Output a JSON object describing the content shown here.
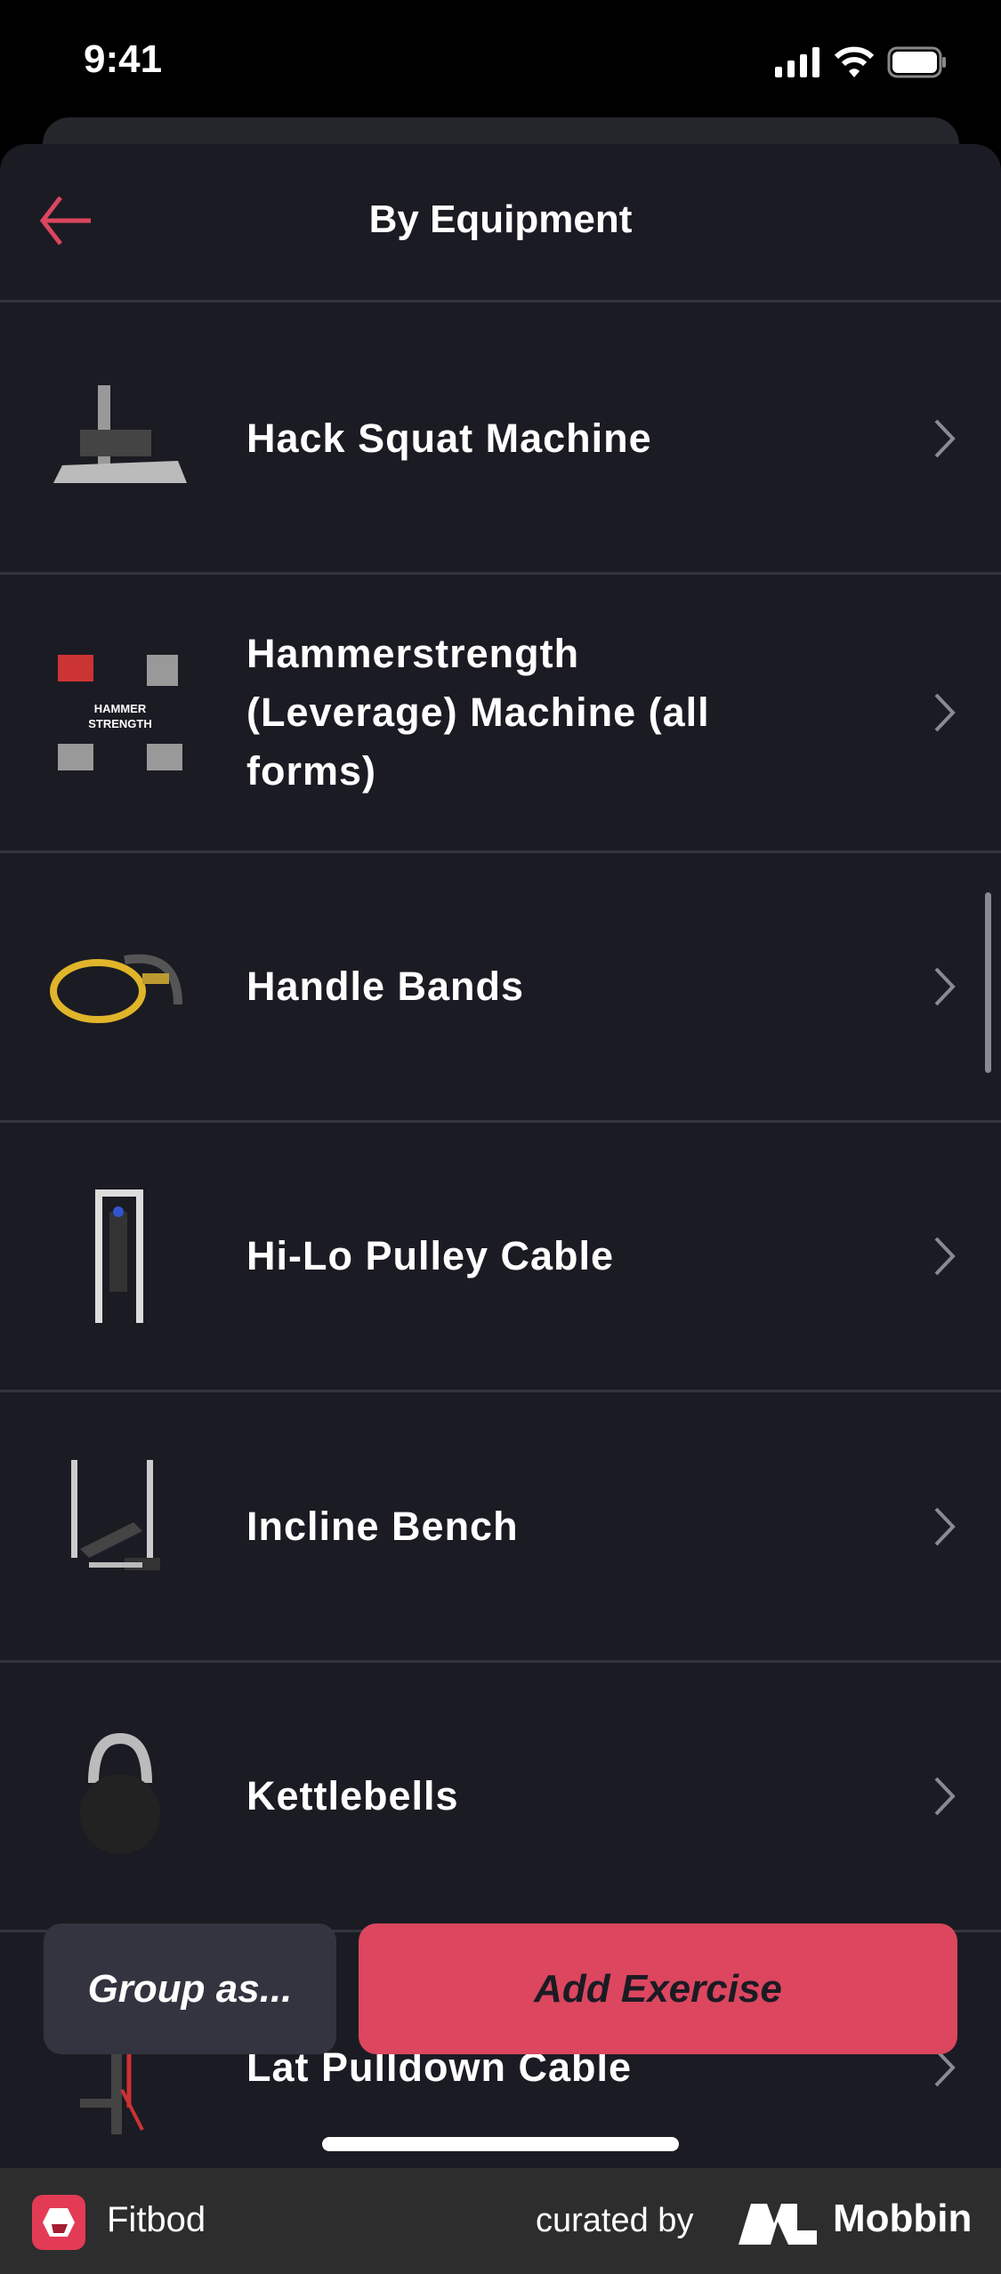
{
  "status_bar": {
    "time": "9:41"
  },
  "header": {
    "title": "By Equipment"
  },
  "items": [
    {
      "label": "Hack Squat Machine"
    },
    {
      "label": "Hammerstrength (Leverage) Machine (all forms)",
      "logo_text": "HAMMER STRENGTH"
    },
    {
      "label": "Handle Bands"
    },
    {
      "label": "Hi-Lo Pulley Cable"
    },
    {
      "label": "Incline Bench"
    },
    {
      "label": "Kettlebells"
    },
    {
      "label": "Lat Pulldown Cable"
    }
  ],
  "actions": {
    "group_label": "Group as...",
    "add_label": "Add Exercise"
  },
  "footer": {
    "app_name": "Fitbod",
    "curated_by": "curated by",
    "brand": "Mobbin"
  },
  "colors": {
    "accent": "#dc465f",
    "background": "#1b1b23",
    "secondary_button": "#33343f"
  }
}
